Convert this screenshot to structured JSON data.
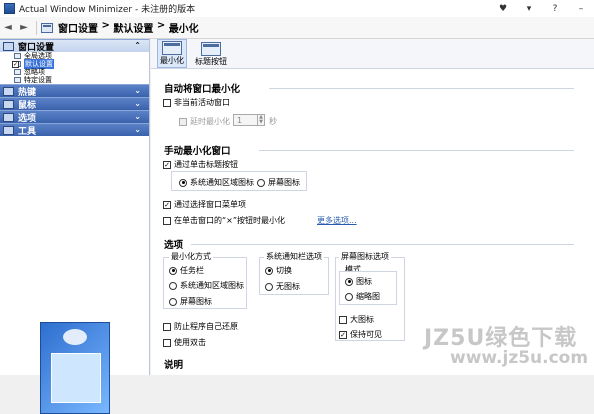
{
  "window": {
    "title": "Actual Window Minimizer - 未注册的版本",
    "controls": [
      "♥",
      "▾",
      "?",
      "–"
    ]
  },
  "breadcrumb": {
    "parts": [
      "窗口设置",
      "默认设置",
      "最小化"
    ],
    "sep": " > "
  },
  "sidebar": {
    "groups": [
      {
        "label": "窗口设置",
        "active": true,
        "chev": "⌃",
        "items": [
          {
            "label": "全局选项"
          },
          {
            "label": "默认设置",
            "selected": true,
            "checked": "✓"
          },
          {
            "label": "忽略项"
          },
          {
            "label": "特定设置"
          }
        ]
      },
      {
        "label": "热键",
        "chev": "⌄"
      },
      {
        "label": "鼠标",
        "chev": "⌄"
      },
      {
        "label": "选项",
        "chev": "⌄"
      },
      {
        "label": "工具",
        "chev": "⌄"
      }
    ]
  },
  "toolbar": {
    "tabs": [
      {
        "label": "最小化",
        "active": true
      },
      {
        "label": "标题按钮"
      }
    ]
  },
  "auto": {
    "title": "自动将窗口最小化",
    "inactive": "非当前活动窗口",
    "minimize_after": "延时最小化",
    "spin_value": "1",
    "unit": "秒"
  },
  "manual": {
    "title": "手动最小化窗口",
    "via_title_button": "通过单击标题按钮",
    "tray_icon": "系统通知区域图标",
    "screen_icon": "屏幕图标",
    "via_menu": "通过选择窗口菜单项",
    "close_button": "在单击窗口的“×”按钮时最小化",
    "more_options": "更多选项..."
  },
  "options": {
    "title": "选项",
    "mode_title": "最小化方式",
    "mode_taskbar": "任务栏",
    "mode_tray": "系统通知区域图标",
    "mode_screen": "屏幕图标",
    "tray_title": "系统通知栏选项",
    "tray_switch": "切换",
    "tray_noicon": "无图标",
    "screen_title": "屏幕图标选项",
    "screen_mode": "模式",
    "screen_icon": "图标",
    "screen_thumb": "缩略图",
    "large_icon": "大图标",
    "keep_visible": "保持可见",
    "prevent_restore": "防止程序自己还原",
    "double_click": "使用双击"
  },
  "notes": {
    "title": "说明"
  },
  "watermark": {
    "line1": "JZ5U绿色下载",
    "line2": "www.jz5u.com"
  }
}
